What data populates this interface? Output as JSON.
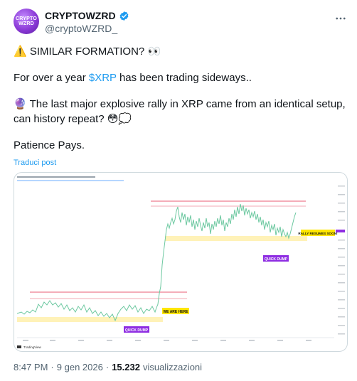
{
  "author": {
    "avatar_text": "CRYPTO\nWZRD",
    "display_name": "CRYPTOWZRD",
    "handle": "@cryptoWZRD_"
  },
  "tweet": {
    "line1_emoji": "⚠️",
    "line1_text": "SIMILAR FORMATION?",
    "line1_emoji_end": "👀",
    "line2_prefix": "For over a year ",
    "line2_cashtag": "$XRP",
    "line2_suffix": " has been trading sideways..",
    "line3_emoji": "🔮",
    "line3_text": "The last major explosive rally in XRP came from an identical setup, can history repeat?",
    "line3_emoji_end": "😳💭",
    "line4_text": "Patience Pays.",
    "translate_label": "Traduci post"
  },
  "chart_image": {
    "annotations": {
      "we_are_here": "WE ARE HERE",
      "quick_dump_left": "QUICK DUMP",
      "quick_dump_right": "QUICK DUMP",
      "rally_resumes": "RALLY RESUMES SOON!"
    },
    "watermark": "TradingView",
    "colors": {
      "line": "#7bd1a9",
      "line_dark": "#2e7d62",
      "support_zone": "#fff2b8",
      "resistance": "#e85b73",
      "label_yellow": "#ffe600",
      "label_purple": "#8e2de2"
    }
  },
  "meta": {
    "time": "8:47 PM",
    "separator": "·",
    "date": "9 gen 2026",
    "separator2": "·",
    "views_count": "15.232",
    "views_label": "visualizzazioni"
  }
}
